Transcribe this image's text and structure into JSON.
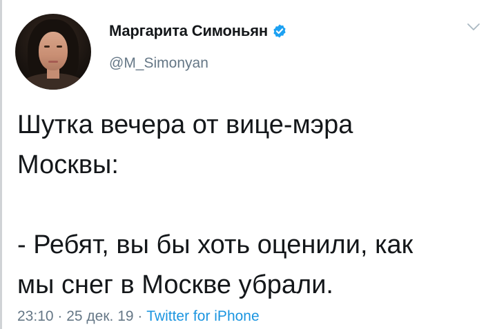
{
  "user": {
    "display_name": "Маргарита Симоньян",
    "handle": "@M_Simonyan",
    "verified": true
  },
  "tweet": {
    "text": "Шутка вечера от вице-мэра\nМосквы:\n\n- Ребят, вы бы хоть оценили, как\nмы снег в Москве убрали."
  },
  "meta": {
    "time": "23:10",
    "separator": " · ",
    "date": "25 дек. 19",
    "source": "Twitter for iPhone"
  },
  "colors": {
    "text": "#14171a",
    "secondary": "#657786",
    "link": "#1b95e0",
    "verified_badge": "#1da1f2"
  },
  "icons": {
    "verified": "verified-badge-icon",
    "menu": "chevron-down-icon"
  }
}
